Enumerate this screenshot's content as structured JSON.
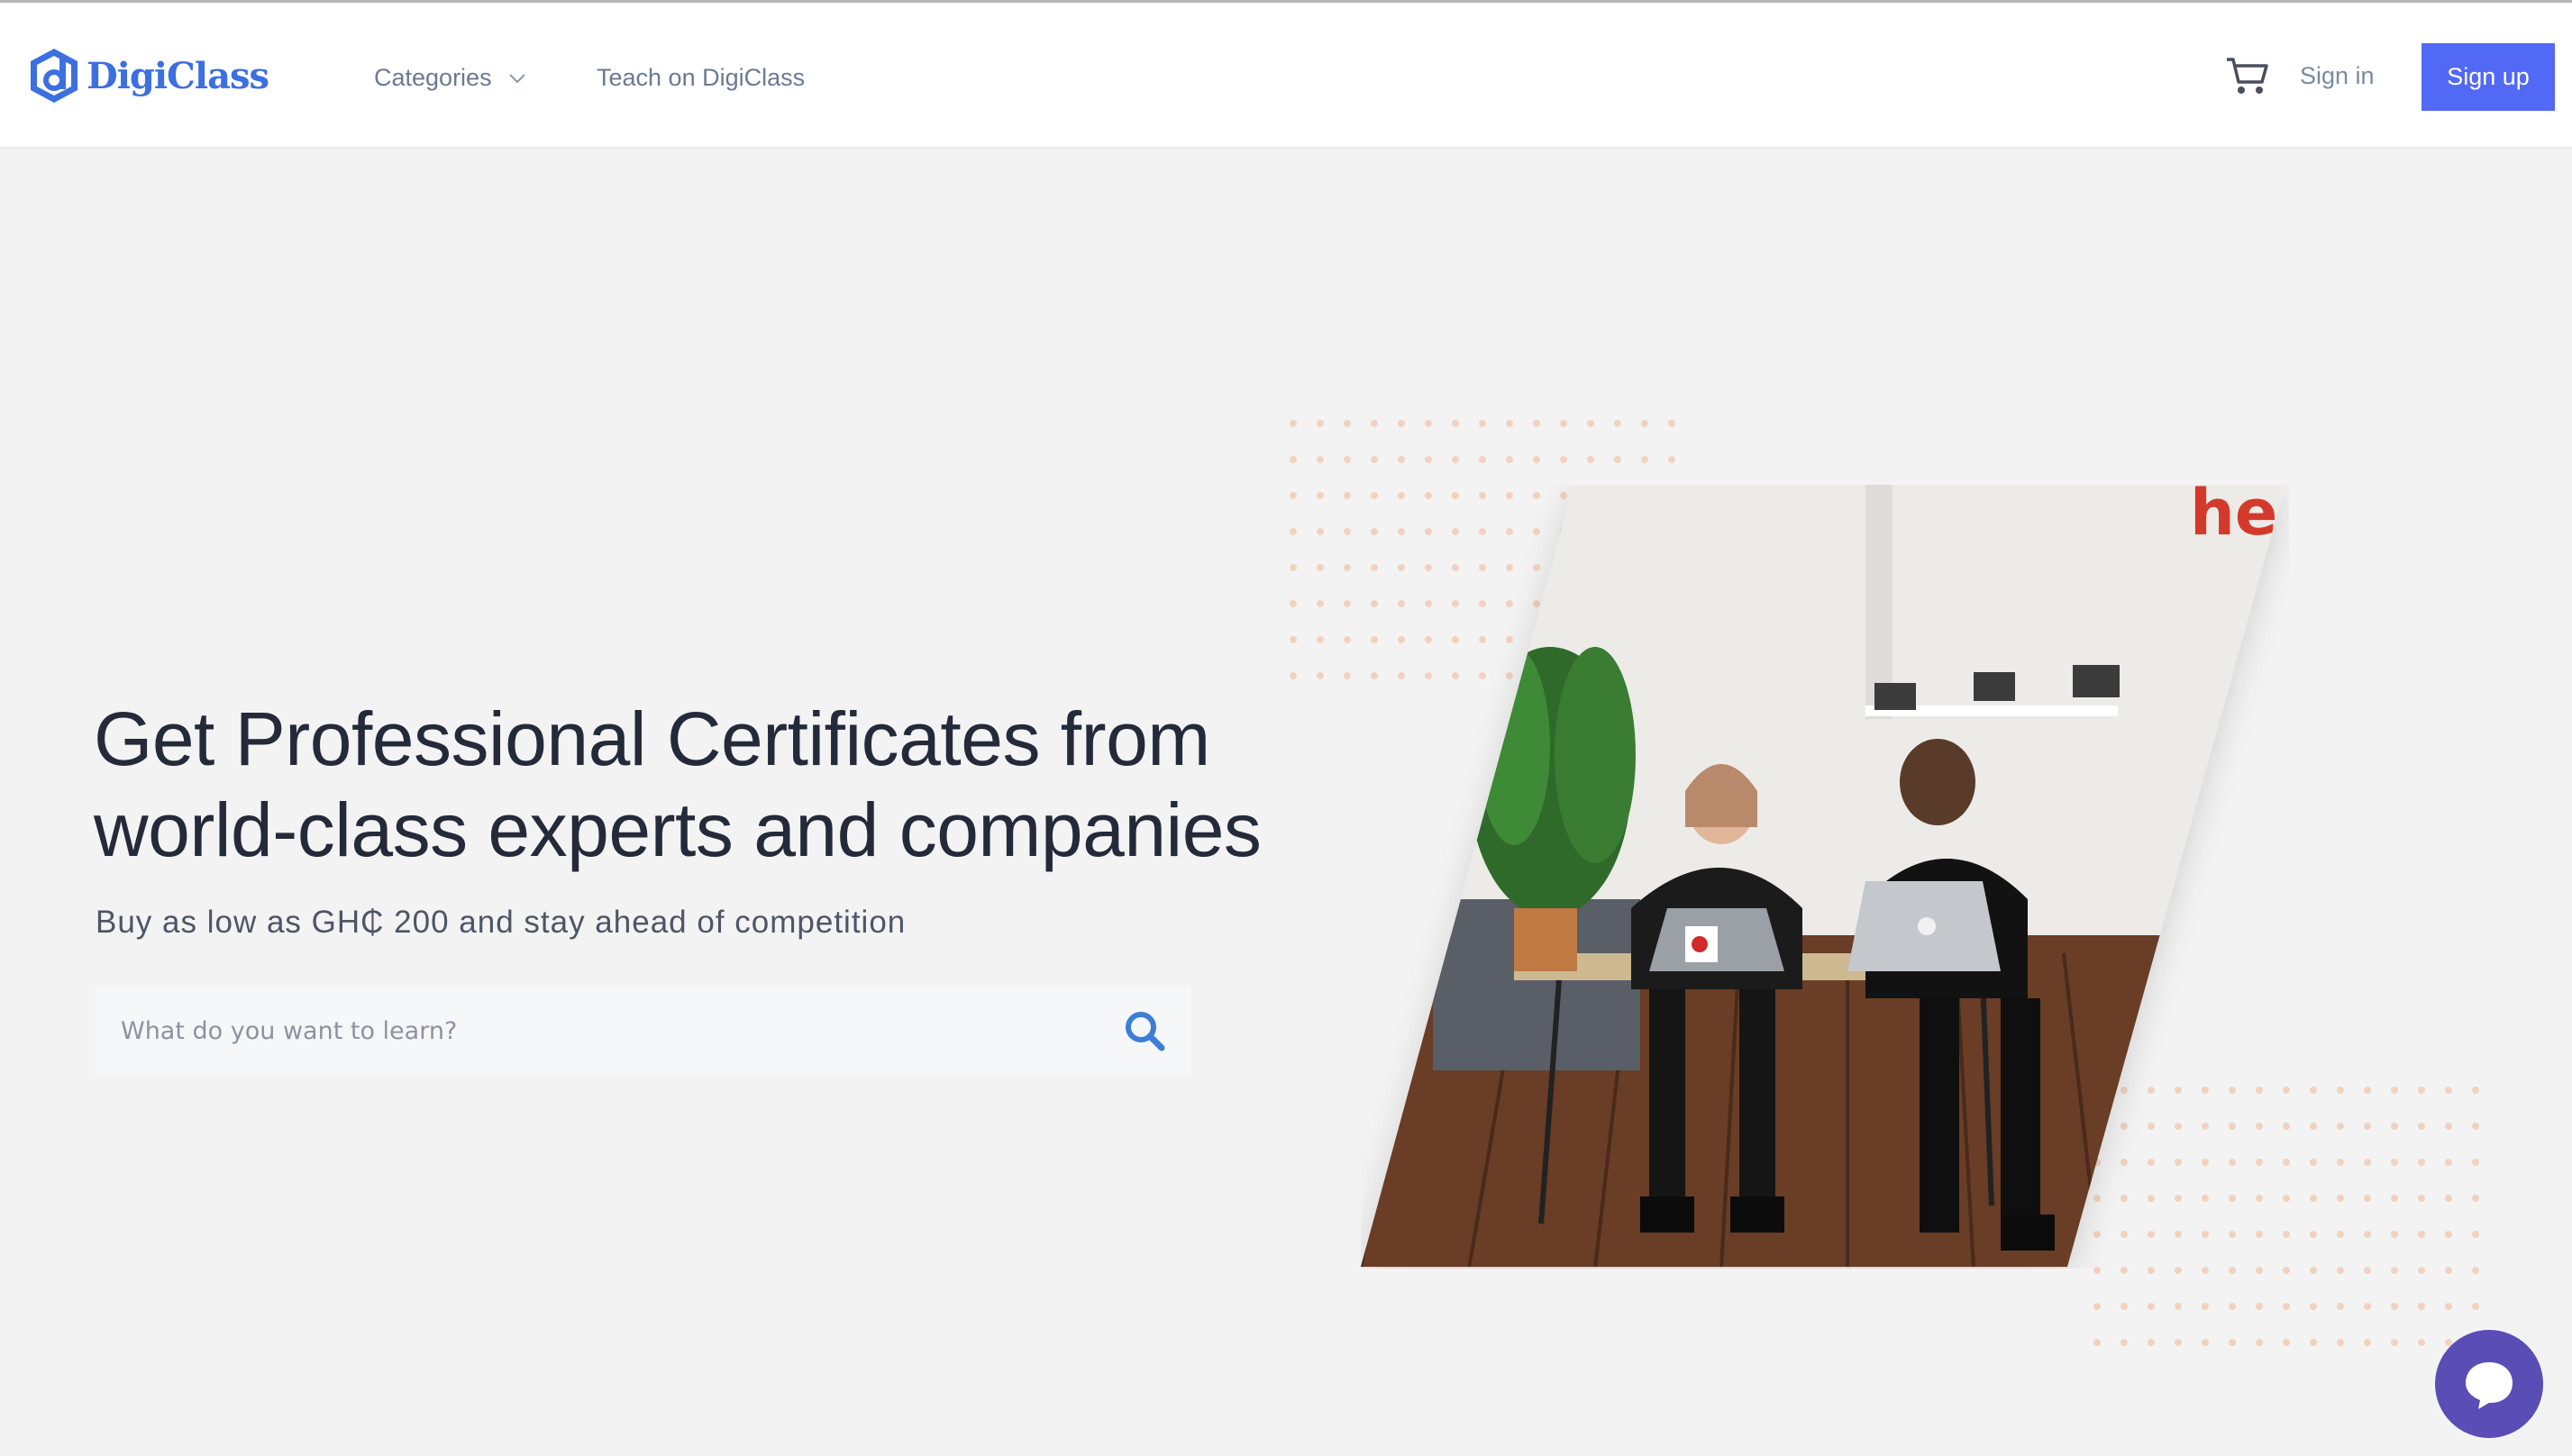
{
  "brand": {
    "name": "DigiClass",
    "color": "#3c6fe0"
  },
  "nav": {
    "categories_label": "Categories",
    "teach_label": "Teach on DigiClass",
    "cart_icon": "cart-icon",
    "signin_label": "Sign in",
    "signup_label": "Sign up",
    "signup_color": "#5269f5"
  },
  "hero": {
    "title_line1": "Get Professional Certificates from",
    "title_line2": "world-class experts and companies",
    "subtitle": "Buy as low as GH₵ 200 and stay ahead of competition",
    "search_placeholder": "What do you want to learn?",
    "search_icon": "search-icon",
    "image": "Two people smiling at laptops at an office table",
    "image_wall_text": "he"
  },
  "chat": {
    "icon": "chat-bubble-icon",
    "color": "#5a4db5"
  }
}
